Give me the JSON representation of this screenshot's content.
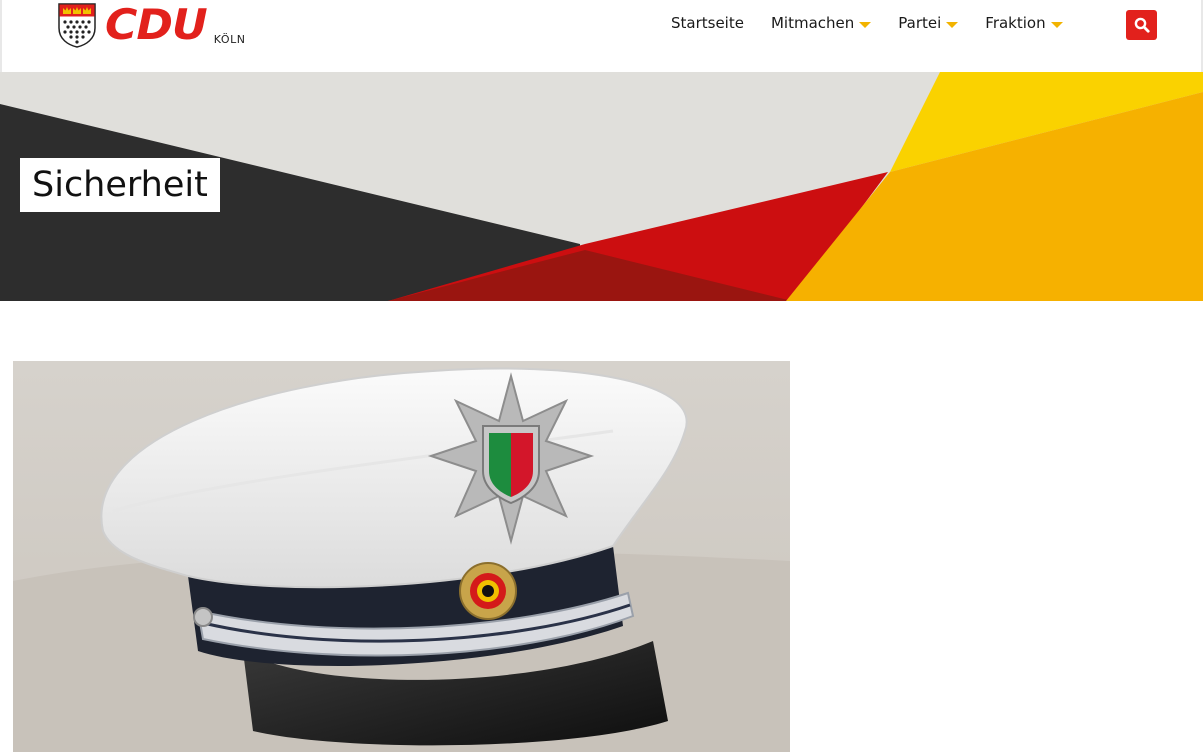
{
  "header": {
    "brand": "CDU",
    "city": "KÖLN",
    "nav": [
      {
        "label": "Startseite",
        "dropdown": false
      },
      {
        "label": "Mitmachen",
        "dropdown": true
      },
      {
        "label": "Partei",
        "dropdown": true
      },
      {
        "label": "Fraktion",
        "dropdown": true
      }
    ],
    "search_icon": "search-icon"
  },
  "hero": {
    "title": "Sicherheit"
  },
  "colors": {
    "brand_red": "#e2211c",
    "caret_yellow": "#f2b300",
    "hero_dark": "#2d2d2d",
    "hero_light": "#e0dfdb",
    "hero_red": "#cc0e10",
    "hero_yellow": "#fad200",
    "hero_orange": "#f6b100"
  }
}
